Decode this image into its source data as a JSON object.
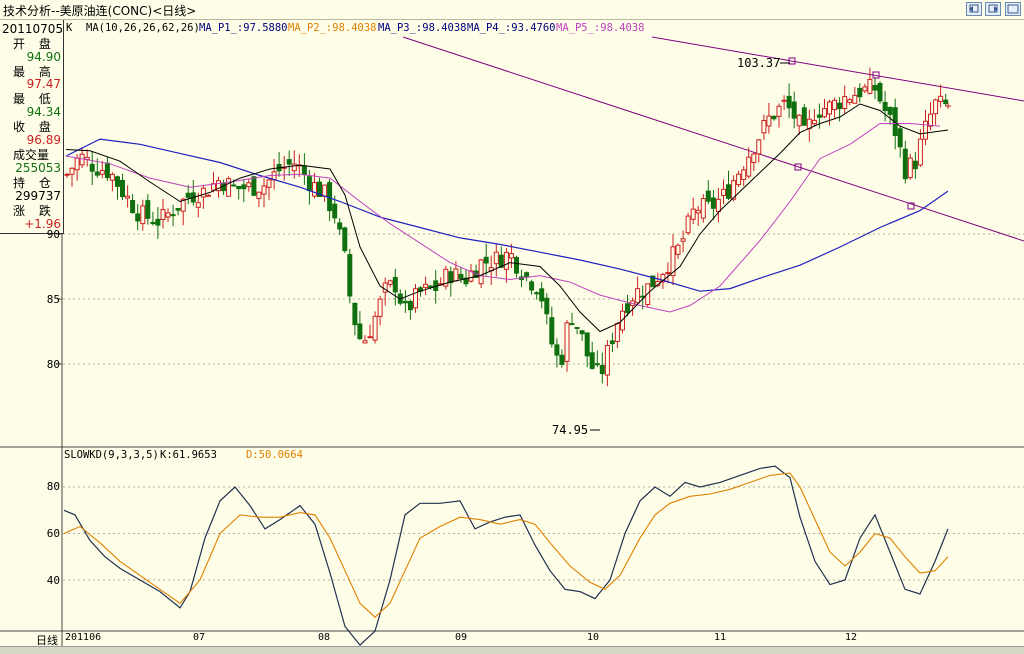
{
  "window": {
    "title": "技术分析--美原油连(CONC)<日线>"
  },
  "info_panel": {
    "date": "20110705",
    "open_label": "开 盘",
    "open_value": "94.90",
    "high_label": "最 高",
    "high_value": "97.47",
    "low_label": "最 低",
    "low_value": "94.34",
    "close_label": "收 盘",
    "close_value": "96.89",
    "volume_label": "成交量",
    "volume_value": "255053",
    "oi_label": "持 仓",
    "oi_value": "299737",
    "change_label": "涨 跌",
    "change_value": "+1.96"
  },
  "main_legend": {
    "k": "K",
    "ma": "MA(10,26,26,62,26)",
    "p1": "MA_P1_:97.5880",
    "p2": "MA_P2_:98.4038",
    "p3": "MA_P3_:98.4038",
    "p4": "MA_P4_:93.4760",
    "p5": "MA_P5_:98.4038"
  },
  "kd_legend": {
    "name": "SLOWKD(9,3,3,5)",
    "k": "K:61.9653",
    "d": "D:50.0664"
  },
  "annotations": {
    "high": "103.37",
    "low": "74.95"
  },
  "y_axis_main": [
    "90",
    "85",
    "80"
  ],
  "y_axis_kd": [
    "80",
    "60",
    "40"
  ],
  "x_axis": {
    "period_label": "日线",
    "ticks": [
      "201106",
      "07",
      "08",
      "09",
      "10",
      "11",
      "12"
    ]
  },
  "colors": {
    "bg": "#fefee8",
    "up": "#cc2020",
    "down": "#107010",
    "ma1": "#000000",
    "ma2": "#e08000",
    "ma3": "#000080",
    "ma4": "#2020c0",
    "ma5": "#c040c0",
    "trend": "#800080"
  }
}
